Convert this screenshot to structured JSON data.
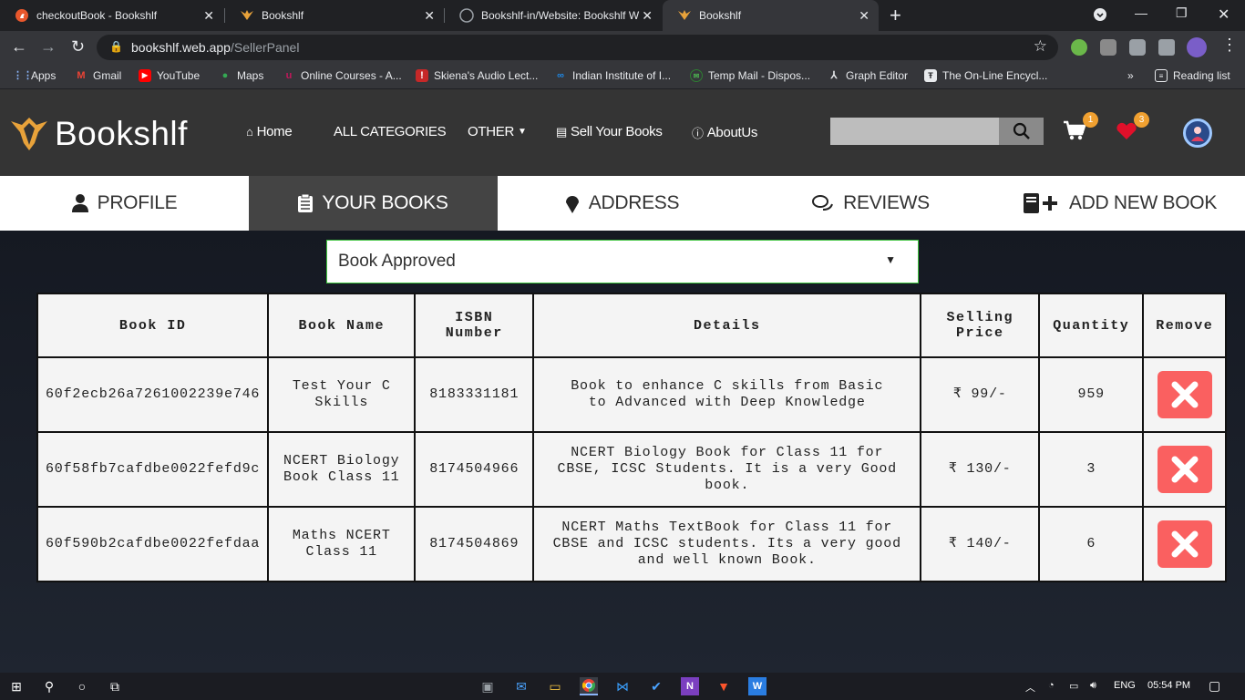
{
  "browser": {
    "tabs": [
      {
        "title": "checkoutBook - Bookshlf",
        "icon": "flame-icon"
      },
      {
        "title": "Bookshlf",
        "icon": "bookshlf-logo-icon"
      },
      {
        "title": "Bookshlf-in/Website: Bookshlf W",
        "icon": "github-icon"
      },
      {
        "title": "Bookshlf",
        "icon": "bookshlf-logo-icon"
      }
    ],
    "active_tab_index": 3,
    "url_host": "bookshlf.web.app",
    "url_path": "/SellerPanel",
    "bookmarks": [
      {
        "label": "Apps",
        "color": "#e8eaed"
      },
      {
        "label": "Gmail",
        "color": "#ea4335"
      },
      {
        "label": "YouTube",
        "color": "#ff0000"
      },
      {
        "label": "Maps",
        "color": "#34a853"
      },
      {
        "label": "Online Courses - A...",
        "color": "#c2185b"
      },
      {
        "label": "Skiena's Audio Lect...",
        "color": "#c62828"
      },
      {
        "label": "Indian Institute of I...",
        "color": "#1e88e5"
      },
      {
        "label": "Temp Mail - Dispos...",
        "color": "#2e7d32"
      },
      {
        "label": "Graph Editor",
        "color": "#e8eaed"
      },
      {
        "label": "The On-Line Encycl...",
        "color": "#e8eaed"
      }
    ],
    "overflow": "»",
    "reading_list": "Reading list"
  },
  "site": {
    "logo_text": "Bookshlf",
    "nav": {
      "home": "Home",
      "categories": "ALL CATEGORIES",
      "other": "OTHER",
      "sell": "Sell Your Books",
      "about": "AboutUs"
    },
    "search_placeholder": "",
    "cart_count": "1",
    "wishlist_count": "3"
  },
  "panel_tabs": [
    {
      "label": "PROFILE",
      "icon": "user-icon"
    },
    {
      "label": "YOUR BOOKS",
      "icon": "clipboard-icon"
    },
    {
      "label": "ADDRESS",
      "icon": "map-pin-icon"
    },
    {
      "label": "REVIEWS",
      "icon": "comments-icon"
    },
    {
      "label": "ADD NEW BOOK",
      "icon": "book-plus-icon"
    }
  ],
  "filter": {
    "selected": "Book Approved"
  },
  "table": {
    "headers": {
      "id": "Book ID",
      "name": "Book Name",
      "isbn": "ISBN Number",
      "details": "Details",
      "price": "Selling Price",
      "qty": "Quantity",
      "remove": "Remove"
    },
    "rows": [
      {
        "id": "60f2ecb26a7261002239e746",
        "name": "Test Your C Skills",
        "isbn": "8183331181",
        "details": "Book to enhance C skills from Basic to Advanced with Deep Knowledge",
        "price": "₹ 99/-",
        "qty": "959"
      },
      {
        "id": "60f58fb7cafdbe0022fefd9c",
        "name": "NCERT Biology Book Class 11",
        "isbn": "8174504966",
        "details": "NCERT Biology Book for Class 11 for CBSE, ICSC Students. It is a very Good book.",
        "price": "₹ 130/-",
        "qty": "3"
      },
      {
        "id": "60f590b2cafdbe0022fefdaa",
        "name": "Maths NCERT Class 11",
        "isbn": "8174504869",
        "details": "NCERT Maths TextBook for Class 11 for CBSE and ICSC students. Its a very good and well known Book.",
        "price": "₹ 140/-",
        "qty": "6"
      }
    ]
  },
  "taskbar": {
    "lang": "ENG",
    "time": "05:54 PM"
  }
}
